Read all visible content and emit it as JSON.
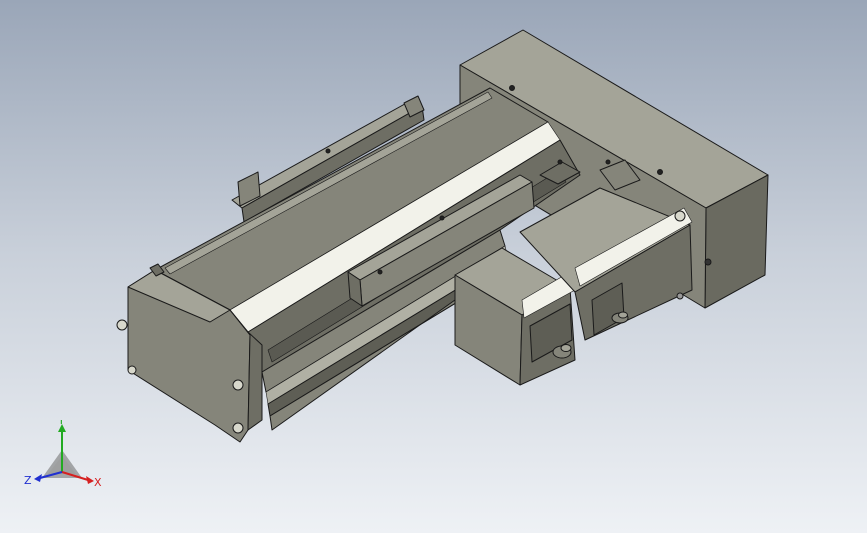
{
  "viewport": {
    "background_top": "#9aa6b8",
    "background_bottom": "#eef1f5"
  },
  "model": {
    "body_color": "#85857a",
    "body_shadow": "#5e5e55",
    "body_light": "#a4a498",
    "highlight": "#f2f2ea",
    "edge_color": "#1a1a1a"
  },
  "triad": {
    "x_label": "X",
    "y_label": "Y",
    "z_label": "Z",
    "x_color": "#d62020",
    "y_color": "#22aa22",
    "z_color": "#2030d0"
  }
}
